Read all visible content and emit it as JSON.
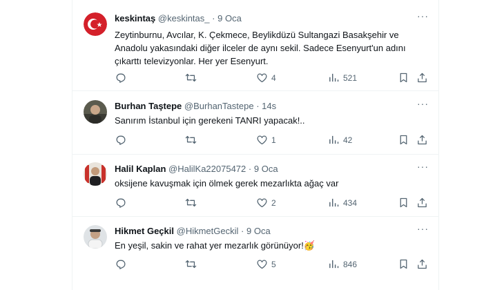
{
  "tweets": [
    {
      "name": "keskintaş",
      "handle": "@keskintas_",
      "dot": "·",
      "time": "9 Oca",
      "text": "Zeytinburnu, Avcılar, K. Çekmece, Beylikdüzü Sultangazi Basakşehir ve Anadolu yakasındaki diğer ilceler de  aynı sekil. Sadece Esenyurt'un adını çıkarttı televizyonlar. Her yer Esenyurt.",
      "reply_count": "",
      "retweet_count": "",
      "like_count": "4",
      "view_count": "521"
    },
    {
      "name": "Burhan Taştepe",
      "handle": "@BurhanTastepe",
      "dot": "·",
      "time": "14s",
      "text": "Sanırım İstanbul için gerekeni TANRI yapacak!..",
      "reply_count": "",
      "retweet_count": "",
      "like_count": "1",
      "view_count": "42"
    },
    {
      "name": "Halil Kaplan",
      "handle": "@HalilKa22075472",
      "dot": "·",
      "time": "9 Oca",
      "text": "oksijene kavuşmak için ölmek gerek mezarlıkta ağaç var",
      "reply_count": "",
      "retweet_count": "",
      "like_count": "2",
      "view_count": "434"
    },
    {
      "name": "Hikmet Geçkil",
      "handle": "@HikmetGeckil",
      "dot": "·",
      "time": "9 Oca",
      "text": "En yeşil, sakin ve rahat yer mezarlık görünüyor!🥳",
      "reply_count": "",
      "retweet_count": "",
      "like_count": "5",
      "view_count": "846"
    }
  ],
  "more_glyph": "···",
  "icons": {
    "reply": "reply-icon",
    "retweet": "retweet-icon",
    "like": "like-icon",
    "views": "views-icon",
    "bookmark": "bookmark-icon",
    "share": "share-icon"
  },
  "colors": {
    "text": "#0f1419",
    "muted": "#536471",
    "border": "#eff3f4"
  }
}
